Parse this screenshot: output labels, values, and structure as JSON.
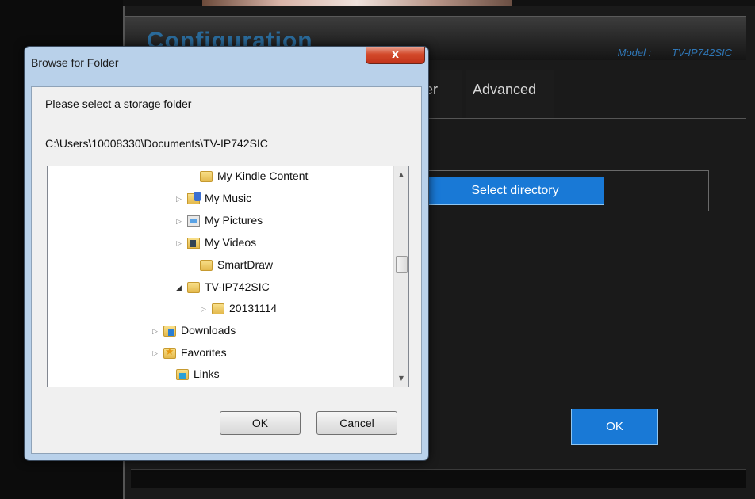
{
  "app": {
    "title": "Configuration",
    "model_label": "Model :",
    "model_value": "TV-IP742SIC",
    "tabs": [
      {
        "label": "er"
      },
      {
        "label": "Advanced"
      }
    ],
    "select_directory_label": "Select directory",
    "ok_label": "OK"
  },
  "dialog": {
    "title": "Browse for Folder",
    "close_glyph": "x",
    "prompt": "Please select a storage folder",
    "path": "C:\\Users\\10008330\\Documents\\TV-IP742SIC",
    "tree": [
      {
        "label": "My Kindle Content",
        "icon": "folder-icon",
        "expander": "none"
      },
      {
        "label": "My Music",
        "icon": "music-folder-icon",
        "expander": "collapsed"
      },
      {
        "label": "My Pictures",
        "icon": "pictures-folder-icon",
        "expander": "collapsed"
      },
      {
        "label": "My Videos",
        "icon": "videos-folder-icon",
        "expander": "collapsed"
      },
      {
        "label": "SmartDraw",
        "icon": "folder-icon",
        "expander": "none"
      },
      {
        "label": "TV-IP742SIC",
        "icon": "folder-icon",
        "expander": "expanded"
      },
      {
        "label": "20131114",
        "icon": "folder-icon",
        "expander": "collapsed"
      },
      {
        "label": "Downloads",
        "icon": "downloads-folder-icon",
        "expander": "collapsed"
      },
      {
        "label": "Favorites",
        "icon": "favorites-folder-icon",
        "expander": "collapsed"
      },
      {
        "label": "Links",
        "icon": "links-folder-icon",
        "expander": "none"
      }
    ],
    "ok_label": "OK",
    "cancel_label": "Cancel"
  },
  "colors": {
    "accent_blue": "#1979d6",
    "model_text": "#2f77b7",
    "close_red": "#c2321a"
  }
}
